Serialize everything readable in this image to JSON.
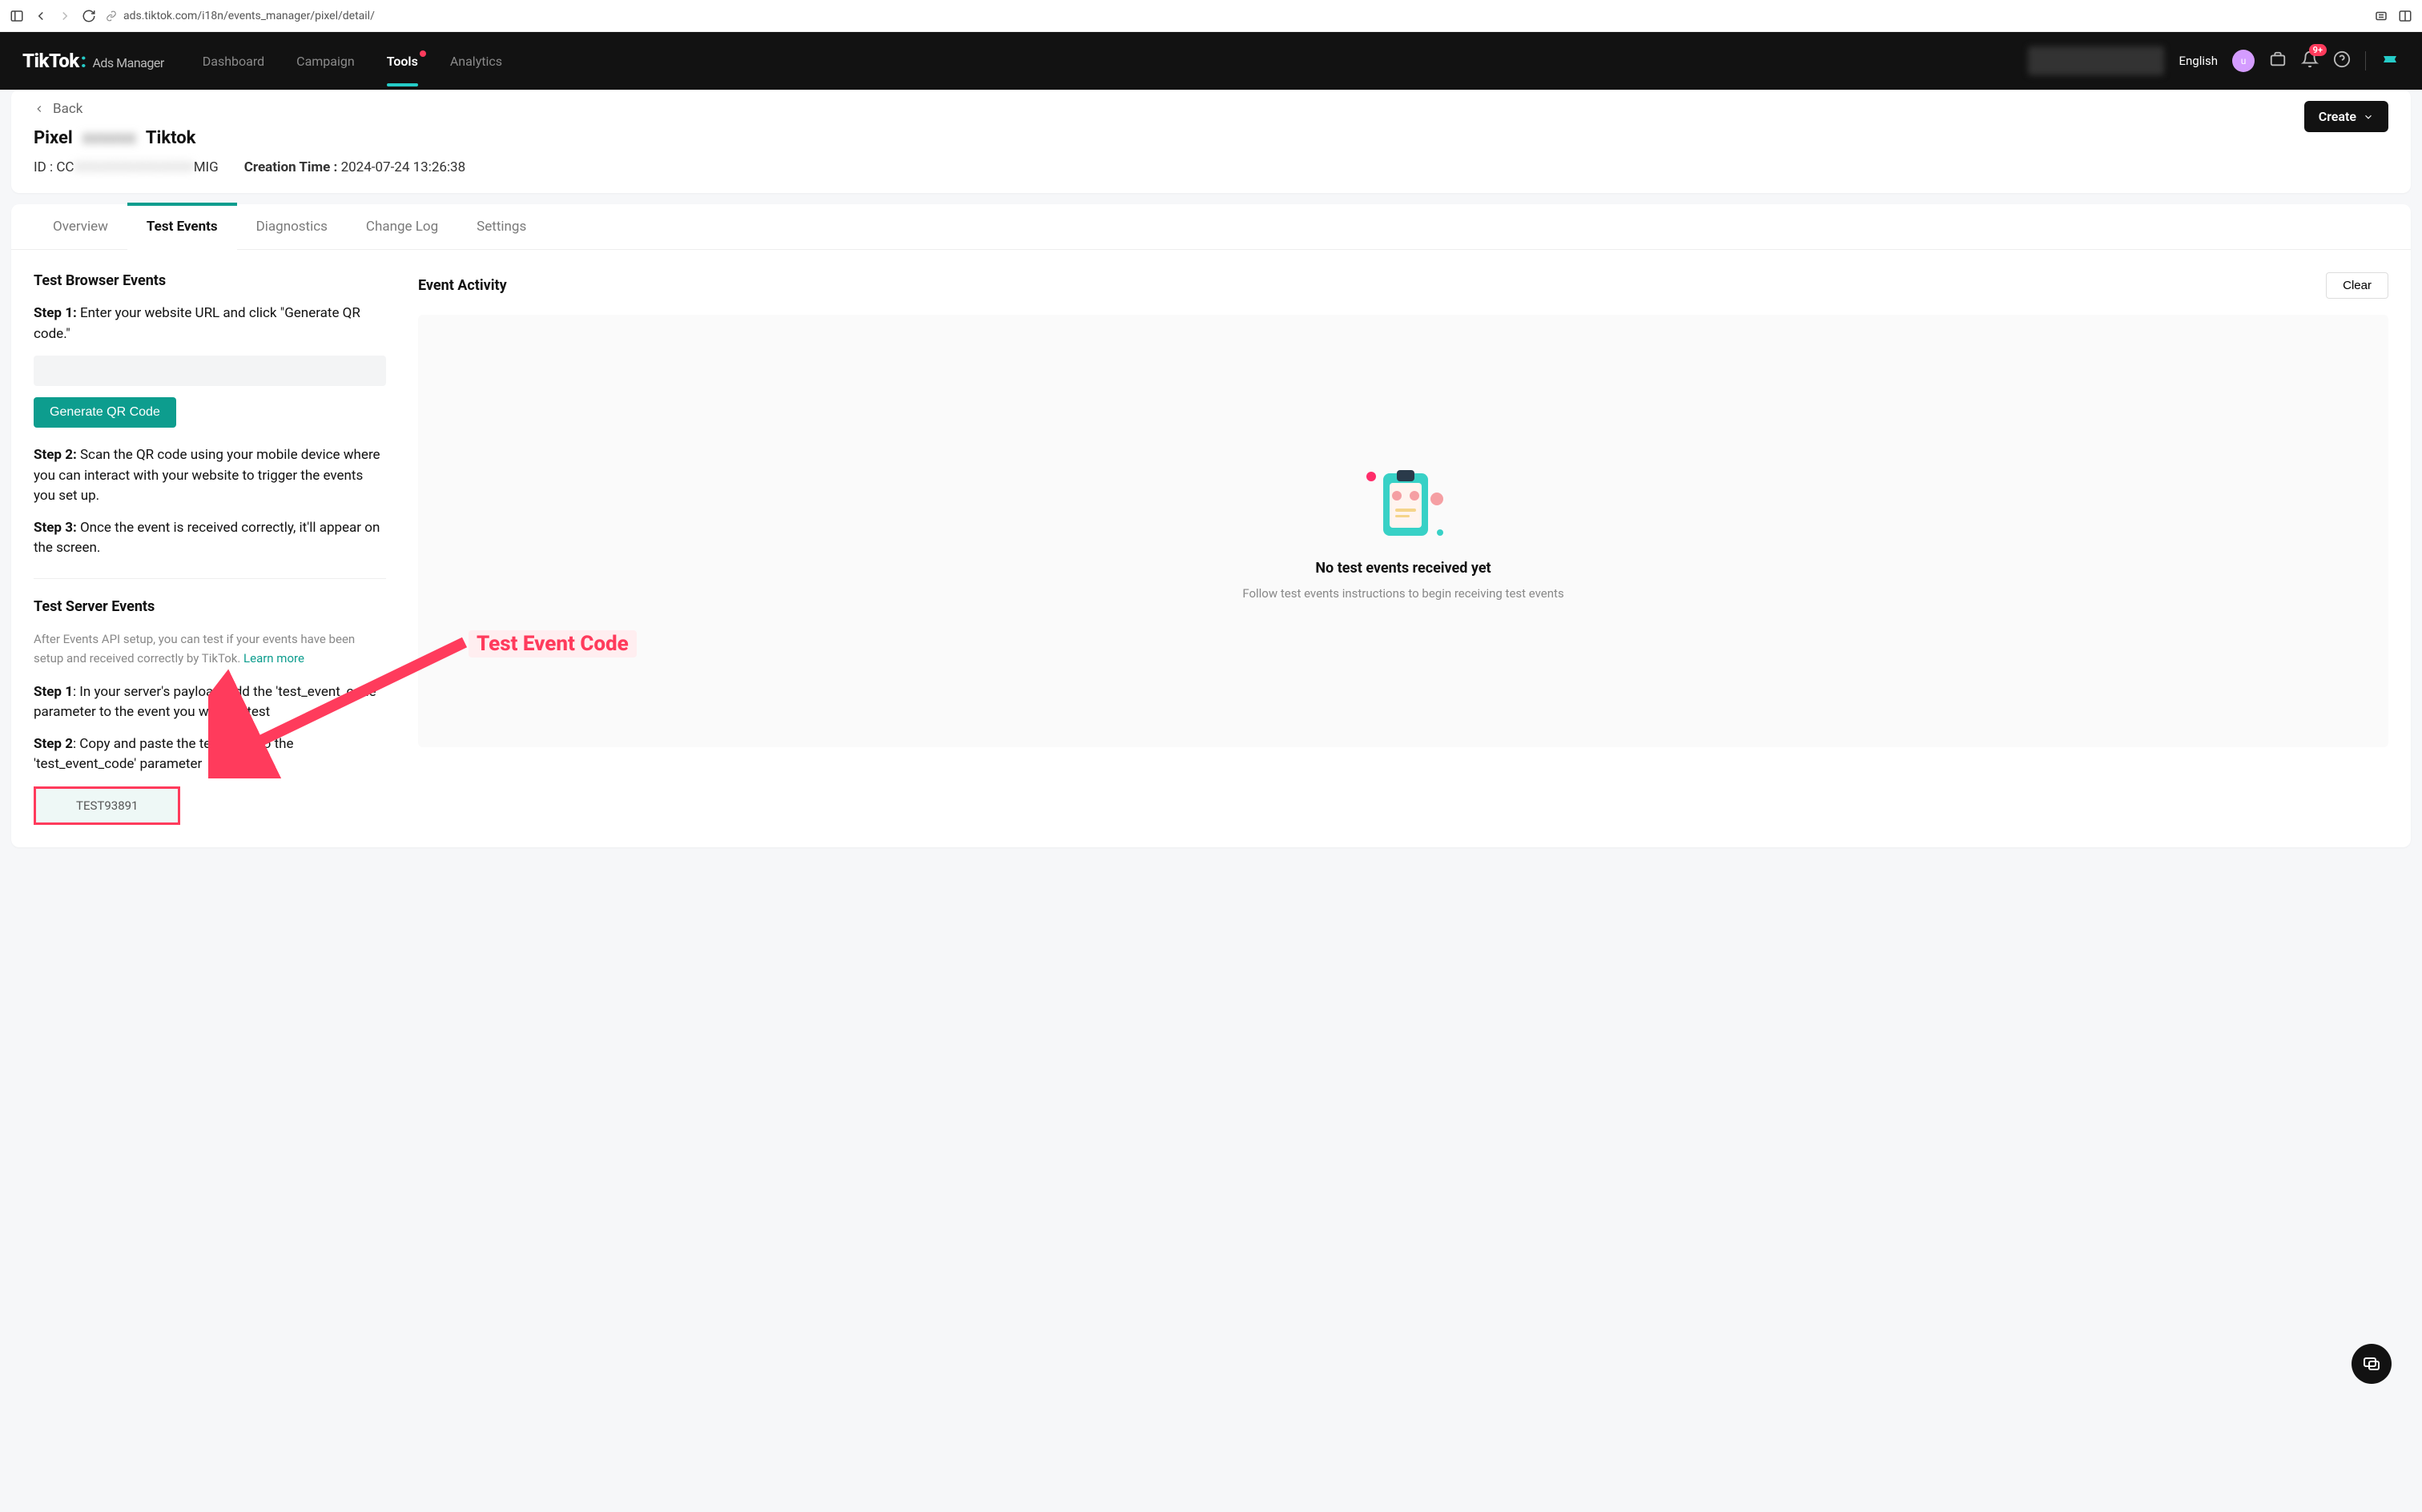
{
  "browser": {
    "url": "ads.tiktok.com/i18n/events_manager/pixel/detail/"
  },
  "nav": {
    "logo_main": "TikTok",
    "logo_sub": "Ads Manager",
    "items": [
      "Dashboard",
      "Campaign",
      "Tools",
      "Analytics"
    ],
    "active": "Tools",
    "lang": "English",
    "avatar_initial": "u",
    "notif_badge": "9+"
  },
  "header": {
    "back": "Back",
    "pixel_prefix": "Pixel",
    "pixel_name": "Tiktok",
    "id_label": "ID :",
    "id_value_prefix": "CC",
    "id_value_suffix": "MIG",
    "creation_label": "Creation Time :",
    "creation_value": "2024-07-24 13:26:38",
    "create_btn": "Create"
  },
  "tabs": [
    "Overview",
    "Test Events",
    "Diagnostics",
    "Change Log",
    "Settings"
  ],
  "active_tab": "Test Events",
  "test_browser": {
    "title": "Test Browser Events",
    "step1": {
      "label": "Step 1:",
      "text": " Enter your website URL and click \"Generate QR code.\""
    },
    "gen_btn": "Generate QR Code",
    "step2": {
      "label": "Step 2:",
      "text": " Scan the QR code using your mobile device where you can interact with your website to trigger the events you set up."
    },
    "step3": {
      "label": "Step 3:",
      "text": " Once the event is received correctly, it'll appear on the screen."
    }
  },
  "test_server": {
    "title": "Test Server Events",
    "subtext": "After Events API setup, you can test if your events have been setup and received correctly by TikTok. ",
    "learn_more": "Learn more",
    "step1": {
      "label": "Step 1",
      "text": ": In your server's payload, add the 'test_event_code' parameter to the event you want to test"
    },
    "step2": {
      "label": "Step 2",
      "text": ": Copy and paste the test code to the 'test_event_code' parameter"
    },
    "code": "TEST93891"
  },
  "activity": {
    "title": "Event Activity",
    "clear": "Clear",
    "empty_title": "No test events received yet",
    "empty_sub": "Follow test events instructions to begin receiving test events"
  },
  "annotation": {
    "label": "Test Event Code"
  }
}
